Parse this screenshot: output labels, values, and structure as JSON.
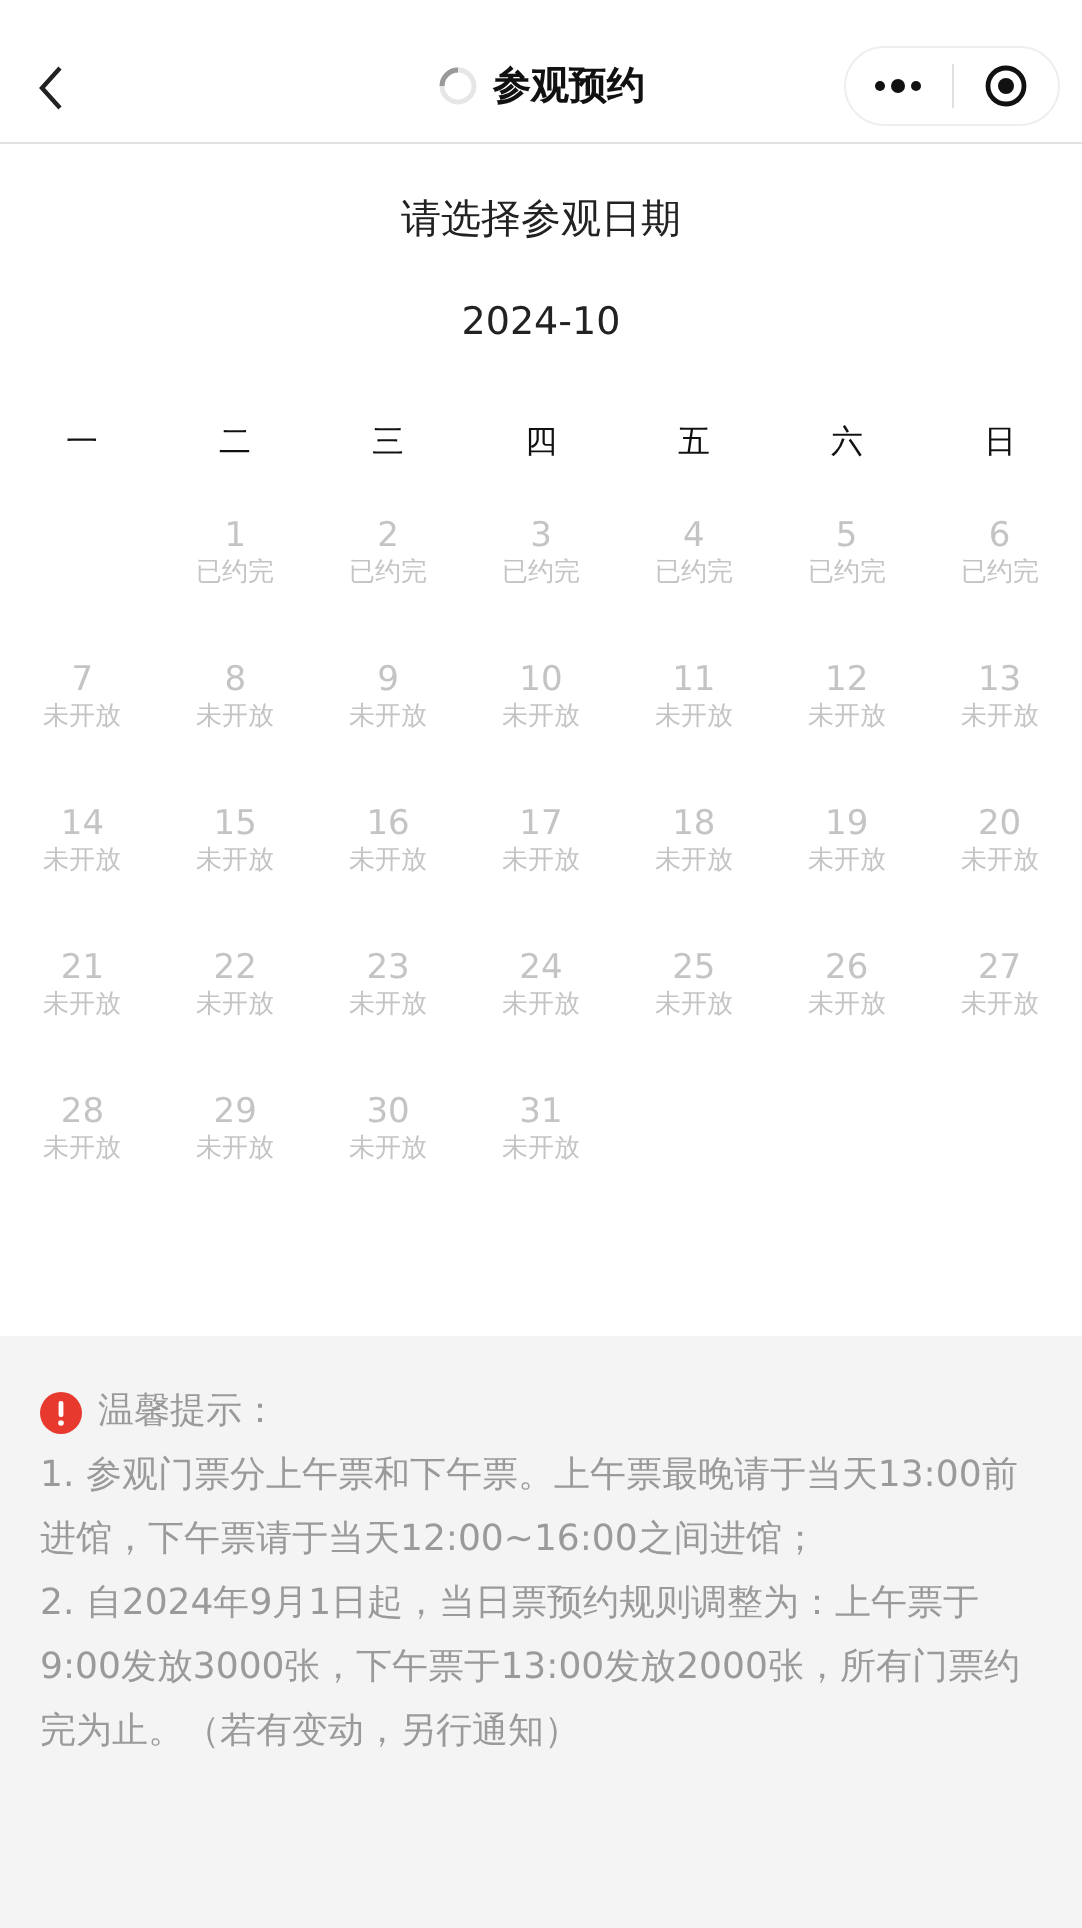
{
  "header": {
    "title": "参观预约",
    "loading": true
  },
  "calendar": {
    "prompt": "请选择参观日期",
    "month": "2024-10",
    "weekdays": [
      "一",
      "二",
      "三",
      "四",
      "五",
      "六",
      "日"
    ],
    "weeks": [
      [
        {
          "day": "1",
          "status": "已约完",
          "disabled": true
        },
        {
          "day": "2",
          "status": "已约完",
          "disabled": true
        },
        {
          "day": "3",
          "status": "已约完",
          "disabled": true
        },
        {
          "day": "4",
          "status": "已约完",
          "disabled": true
        },
        {
          "day": "5",
          "status": "已约完",
          "disabled": true
        },
        {
          "day": "6",
          "status": "已约完",
          "disabled": true
        }
      ],
      [
        {
          "day": "7",
          "status": "未开放",
          "disabled": true
        },
        {
          "day": "8",
          "status": "未开放",
          "disabled": true
        },
        {
          "day": "9",
          "status": "未开放",
          "disabled": true
        },
        {
          "day": "10",
          "status": "未开放",
          "disabled": true
        },
        {
          "day": "11",
          "status": "未开放",
          "disabled": true
        },
        {
          "day": "12",
          "status": "未开放",
          "disabled": true
        },
        {
          "day": "13",
          "status": "未开放",
          "disabled": true
        }
      ],
      [
        {
          "day": "14",
          "status": "未开放",
          "disabled": true
        },
        {
          "day": "15",
          "status": "未开放",
          "disabled": true
        },
        {
          "day": "16",
          "status": "未开放",
          "disabled": true
        },
        {
          "day": "17",
          "status": "未开放",
          "disabled": true
        },
        {
          "day": "18",
          "status": "未开放",
          "disabled": true
        },
        {
          "day": "19",
          "status": "未开放",
          "disabled": true
        },
        {
          "day": "20",
          "status": "未开放",
          "disabled": true
        }
      ],
      [
        {
          "day": "21",
          "status": "未开放",
          "disabled": true
        },
        {
          "day": "22",
          "status": "未开放",
          "disabled": true
        },
        {
          "day": "23",
          "status": "未开放",
          "disabled": true
        },
        {
          "day": "24",
          "status": "未开放",
          "disabled": true
        },
        {
          "day": "25",
          "status": "未开放",
          "disabled": true
        },
        {
          "day": "26",
          "status": "未开放",
          "disabled": true
        },
        {
          "day": "27",
          "status": "未开放",
          "disabled": true
        }
      ],
      [
        {
          "day": "28",
          "status": "未开放",
          "disabled": true
        },
        {
          "day": "29",
          "status": "未开放",
          "disabled": true
        },
        {
          "day": "30",
          "status": "未开放",
          "disabled": true
        },
        {
          "day": "31",
          "status": "未开放",
          "disabled": true
        }
      ]
    ]
  },
  "notice": {
    "title": "温馨提示：",
    "items": [
      "1. 参观门票分上午票和下午票。上午票最晚请于当天13:00前进馆，下午票请于当天12:00~16:00之间进馆；",
      "2. 自2024年9月1日起，当日票预约规则调整为：上午票于9:00发放3000张，下午票于13:00发放2000张，所有门票约完为止。（若有变动，另行通知）"
    ]
  }
}
